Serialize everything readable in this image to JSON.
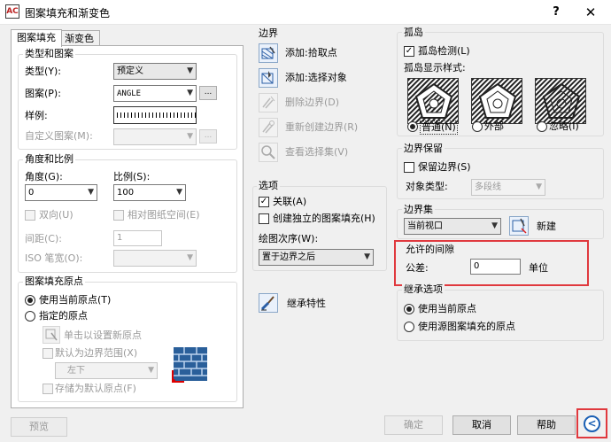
{
  "window": {
    "title": "图案填充和渐变色",
    "help": "?",
    "close": "✕",
    "app_icon": "AC"
  },
  "tabs": [
    {
      "label": "图案填充"
    },
    {
      "label": "渐变色"
    }
  ],
  "type_pattern": {
    "heading": "类型和图案",
    "type_label": "类型(Y):",
    "type_value": "预定义",
    "pattern_label": "图案(P):",
    "pattern_value": "ANGLE",
    "ellipsis": "...",
    "swatch_label": "样例:",
    "custom_label": "自定义图案(M):"
  },
  "angle_scale": {
    "heading": "角度和比例",
    "angle_label": "角度(G):",
    "angle_value": "0",
    "scale_label": "比例(S):",
    "scale_value": "100",
    "double_label": "双向(U)",
    "relative_label": "相对图纸空间(E)",
    "spacing_label": "间距(C):",
    "spacing_value": "1",
    "iso_label": "ISO 笔宽(O):"
  },
  "origin": {
    "heading": "图案填充原点",
    "use_current": "使用当前原点(T)",
    "specified": "指定的原点",
    "click_set": "单击以设置新原点",
    "default_extents": "默认为边界范围(X)",
    "position_value": "左下",
    "store_default": "存储为默认原点(F)"
  },
  "boundaries": {
    "heading": "边界",
    "add_pick": "添加:拾取点",
    "add_select": "添加:选择对象",
    "remove": "删除边界(D)",
    "recreate": "重新创建边界(R)",
    "view": "查看选择集(V)"
  },
  "options": {
    "heading": "选项",
    "associative": "关联(A)",
    "separate": "创建独立的图案填充(H)",
    "draw_order_label": "绘图次序(W):",
    "draw_order_value": "置于边界之后"
  },
  "inherit": {
    "label": "继承特性"
  },
  "islands": {
    "heading": "孤岛",
    "detection": "孤岛检测(L)",
    "style_label": "孤岛显示样式:",
    "normal": "普通(N)",
    "outer": "外部",
    "ignore": "忽略(I)"
  },
  "boundary_retention": {
    "heading": "边界保留",
    "retain": "保留边界(S)",
    "object_type_label": "对象类型:",
    "object_type_value": "多段线"
  },
  "boundary_set": {
    "heading": "边界集",
    "value": "当前视口",
    "new_label": "新建"
  },
  "gap_tolerance": {
    "heading": "允许的间隙",
    "label": "公差:",
    "value": "0",
    "unit": "单位"
  },
  "inherit_options": {
    "heading": "继承选项",
    "use_current": "使用当前原点",
    "use_source": "使用源图案填充的原点"
  },
  "footer": {
    "preview": "预览",
    "ok": "确定",
    "cancel": "取消",
    "help": "帮助",
    "collapse": "<"
  },
  "colors": {
    "highlight": "#e0393e",
    "accent": "#1a5fb4"
  }
}
